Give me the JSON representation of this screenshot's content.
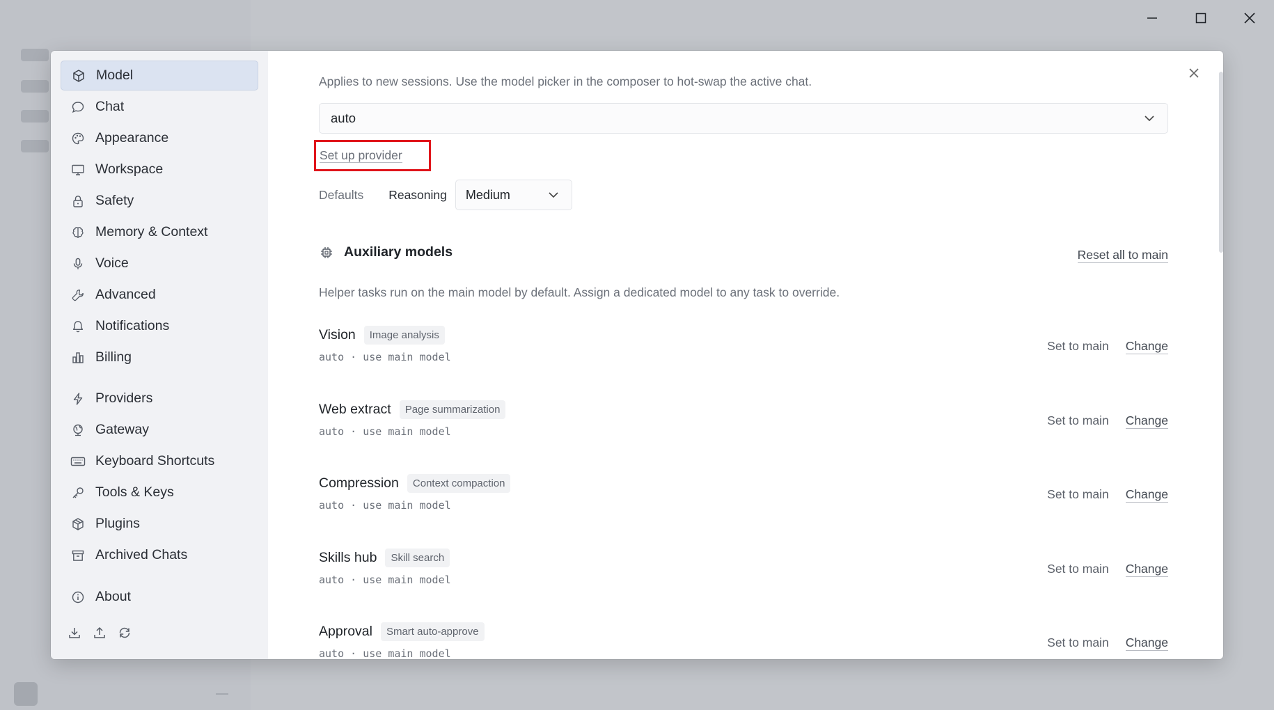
{
  "sidebar": {
    "items": [
      {
        "label": "Model",
        "icon": "cube-icon",
        "active": true
      },
      {
        "label": "Chat",
        "icon": "chat-bubble-icon"
      },
      {
        "label": "Appearance",
        "icon": "palette-icon"
      },
      {
        "label": "Workspace",
        "icon": "monitor-icon"
      },
      {
        "label": "Safety",
        "icon": "lock-icon"
      },
      {
        "label": "Memory & Context",
        "icon": "brain-icon"
      },
      {
        "label": "Voice",
        "icon": "microphone-icon"
      },
      {
        "label": "Advanced",
        "icon": "wrench-icon"
      },
      {
        "label": "Notifications",
        "icon": "bell-icon"
      },
      {
        "label": "Billing",
        "icon": "bar-chart-icon"
      },
      {
        "label": "Providers",
        "icon": "lightning-icon"
      },
      {
        "label": "Gateway",
        "icon": "globe-icon"
      },
      {
        "label": "Keyboard Shortcuts",
        "icon": "keyboard-icon"
      },
      {
        "label": "Tools & Keys",
        "icon": "key-icon"
      },
      {
        "label": "Plugins",
        "icon": "package-icon"
      },
      {
        "label": "Archived Chats",
        "icon": "archive-icon"
      },
      {
        "label": "About",
        "icon": "info-icon"
      }
    ],
    "bottom_icons": [
      "download-icon",
      "upload-icon",
      "refresh-icon"
    ]
  },
  "main": {
    "description": "Applies to new sessions. Use the model picker in the composer to hot-swap the active chat.",
    "model_value": "auto",
    "setup_provider": "Set up provider",
    "defaults_label": "Defaults",
    "reasoning_label": "Reasoning",
    "reasoning_value": "Medium",
    "aux_title": "Auxiliary models",
    "reset_all": "Reset all to main",
    "aux_description": "Helper tasks run on the main model by default. Assign a dedicated model to any task to override.",
    "set_to_main": "Set to main",
    "change": "Change",
    "tasks": [
      {
        "title": "Vision",
        "tag": "Image analysis",
        "sub": "auto · use main model"
      },
      {
        "title": "Web extract",
        "tag": "Page summarization",
        "sub": "auto · use main model"
      },
      {
        "title": "Compression",
        "tag": "Context compaction",
        "sub": "auto · use main model"
      },
      {
        "title": "Skills hub",
        "tag": "Skill search",
        "sub": "auto · use main model"
      },
      {
        "title": "Approval",
        "tag": "Smart auto-approve",
        "sub": "auto · use main model"
      }
    ]
  },
  "colors": {
    "active_nav_bg": "#dbe3f1",
    "highlight_box": "#e0151b"
  }
}
